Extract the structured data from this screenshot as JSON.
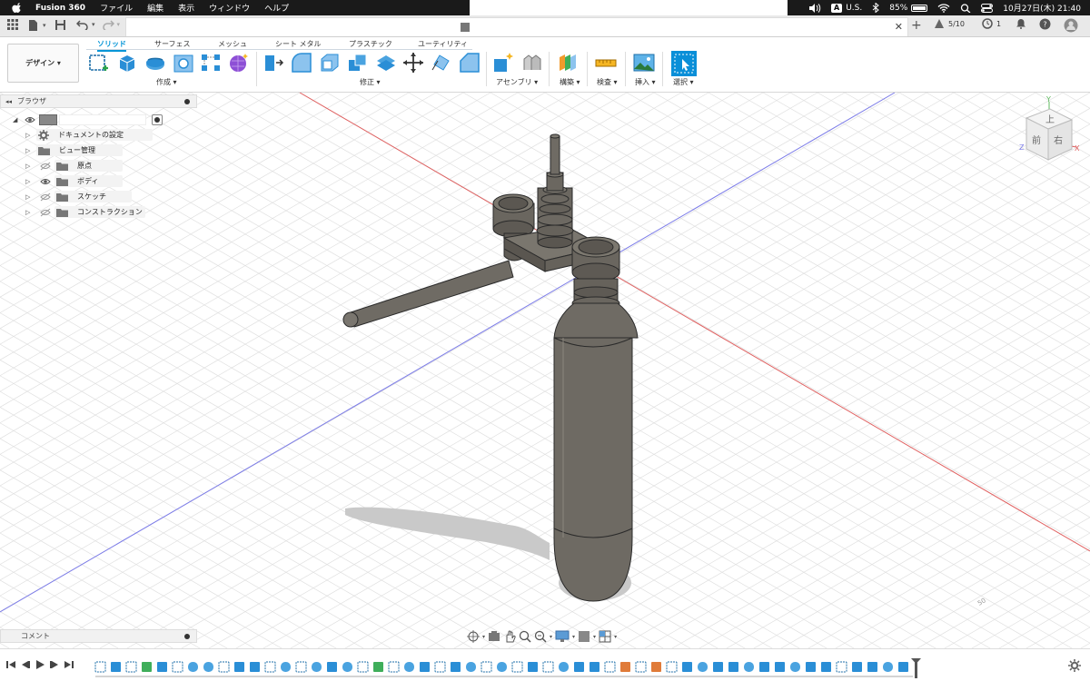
{
  "menubar": {
    "app_name": "Fusion 360",
    "menus": [
      "ファイル",
      "編集",
      "表示",
      "ウィンドウ",
      "ヘルプ"
    ],
    "input_source": "A",
    "input_label": "U.S.",
    "battery_percent": "85%",
    "battery_level": 0.85,
    "clock": "10月27日(木) 21:40"
  },
  "tabbar": {
    "jobs_label": "5/10",
    "notifications_count": "1"
  },
  "toolbar": {
    "workspace_label": "デザイン ▾",
    "tabs": [
      "ソリッド",
      "サーフェス",
      "メッシュ",
      "シート メタル",
      "プラスチック",
      "ユーティリティ"
    ],
    "active_tab": "ソリッド",
    "groups": [
      "作成 ▾",
      "修正 ▾",
      "アセンブリ ▾",
      "構築 ▾",
      "検査 ▾",
      "挿入 ▾",
      "選択 ▾"
    ]
  },
  "browser": {
    "title": "ブラウザ",
    "items": [
      {
        "label": "ドキュメントの設定",
        "icon": "gear-icon"
      },
      {
        "label": "ビュー管理",
        "icon": "folder-icon"
      },
      {
        "label": "原点",
        "icon": "folder-icon"
      },
      {
        "label": "ボディ",
        "icon": "folder-icon"
      },
      {
        "label": "スケッチ",
        "icon": "folder-icon"
      },
      {
        "label": "コンストラクション",
        "icon": "folder-icon"
      }
    ]
  },
  "comments": {
    "title": "コメント"
  },
  "viewcube": {
    "top": "上",
    "front": "前",
    "right": "右",
    "axis_y": "Y",
    "axis_x": "X",
    "axis_z": "Z"
  },
  "colors": {
    "accent": "#0696d7",
    "model": "#6b6760",
    "grid": "#dcdcdc",
    "x_axis": "#e06060",
    "z_axis": "#7c7ce8",
    "y_axis": "#5cb85c"
  }
}
